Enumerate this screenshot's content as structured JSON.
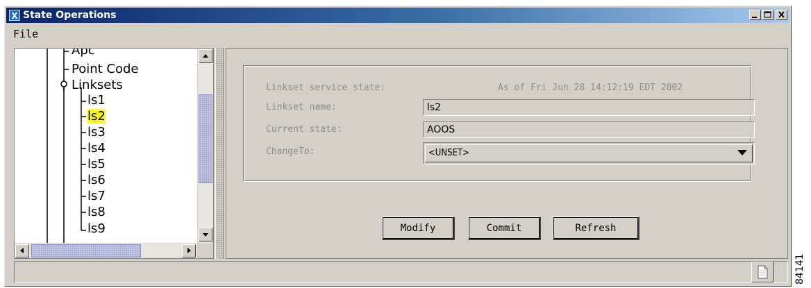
{
  "window": {
    "title": "State Operations",
    "app_icon_glyph": "X",
    "controls": [
      "minimize",
      "maximize",
      "close"
    ]
  },
  "menu": {
    "items": [
      "File"
    ]
  },
  "tree": {
    "nodes": [
      {
        "label": "Apc",
        "selected": false
      },
      {
        "label": "Point Code",
        "selected": false
      },
      {
        "label": "Linksets",
        "selected": false,
        "expanded": true
      },
      {
        "label": "ls1",
        "selected": false
      },
      {
        "label": "ls2",
        "selected": true
      },
      {
        "label": "ls3",
        "selected": false
      },
      {
        "label": "ls4",
        "selected": false
      },
      {
        "label": "ls5",
        "selected": false
      },
      {
        "label": "ls6",
        "selected": false
      },
      {
        "label": "ls7",
        "selected": false
      },
      {
        "label": "ls8",
        "selected": false
      },
      {
        "label": "ls9",
        "selected": false
      }
    ],
    "selected_highlight_color": "#ffff00"
  },
  "form": {
    "service_state_label": "Linkset service state:",
    "timestamp": "As of Fri Jun 28 14:12:19 EDT 2002",
    "name_label": "Linkset name:",
    "name_value": "ls2",
    "state_label": "Current state:",
    "state_value": "AOOS",
    "change_label": "ChangeTo:",
    "change_value": "<UNSET>"
  },
  "buttons": {
    "modify": "Modify",
    "commit": "Commit",
    "refresh": "Refresh"
  },
  "side_id": "84141",
  "colors": {
    "title_gradient_start": "#0a246a",
    "title_gradient_end": "#a6caf0",
    "label_gray": "#8c8c8c",
    "scroll_thumb": "#c6c9e6"
  }
}
